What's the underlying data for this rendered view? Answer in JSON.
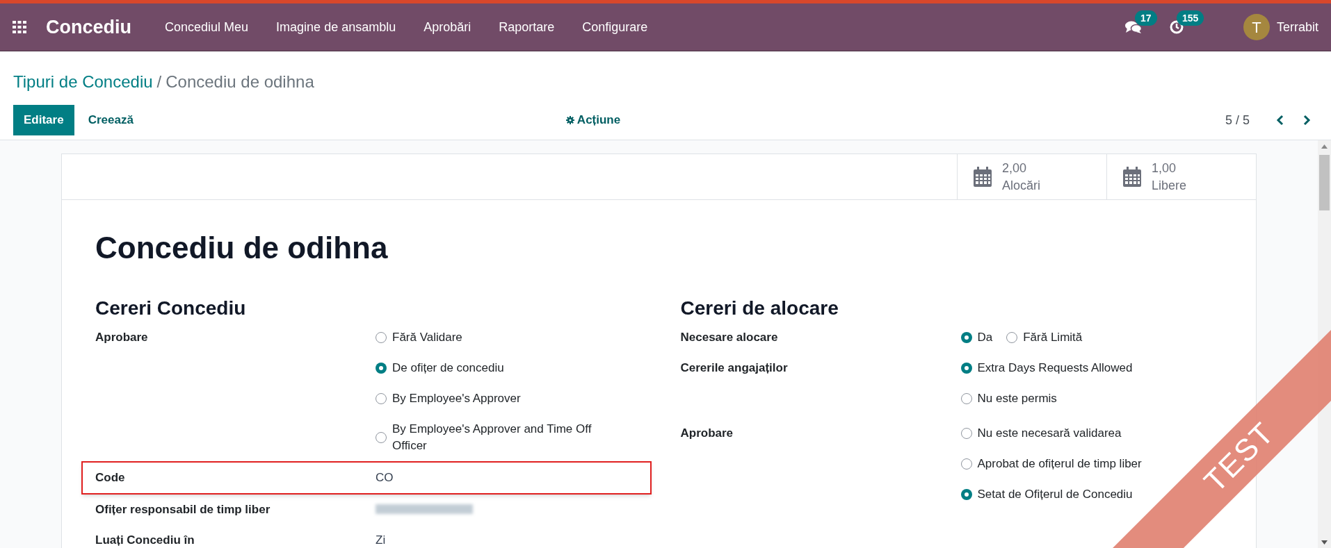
{
  "navbar": {
    "app_title": "Concediu",
    "menu": [
      "Concediul Meu",
      "Imagine de ansamblu",
      "Aprobări",
      "Raportare",
      "Configurare"
    ],
    "messages_badge": "17",
    "activity_badge": "155",
    "user": {
      "initial": "T",
      "name": "Terrabit"
    }
  },
  "breadcrumb": {
    "parent": "Tipuri de Concediu",
    "separator": "/",
    "current": "Concediu de odihna"
  },
  "control_panel": {
    "edit_button": "Editare",
    "create_button": "Creează",
    "action_button": "Acțiune",
    "pager": "5 / 5"
  },
  "stat_buttons": [
    {
      "value": "2,00",
      "label": "Alocări"
    },
    {
      "value": "1,00",
      "label": "Libere"
    }
  ],
  "title": "Concediu de odihna",
  "sections": [
    {
      "heading": "Cereri Concediu",
      "fields": [
        {
          "label": "Aprobare",
          "kind": "radio",
          "options": [
            {
              "label": "Fără Validare",
              "selected": false
            },
            {
              "label": "De ofițer de concediu",
              "selected": true
            },
            {
              "label": "By Employee's Approver",
              "selected": false
            },
            {
              "label": "By Employee's Approver and Time Off Officer",
              "selected": false
            }
          ]
        },
        {
          "label": "Code",
          "kind": "text",
          "value": "CO",
          "highlighted": true
        },
        {
          "label": "Ofițer responsabil de timp liber",
          "kind": "blurred"
        },
        {
          "label": "Luați Concediu în",
          "kind": "text",
          "value": "Zi",
          "highlighted": false
        }
      ]
    },
    {
      "heading": "Cereri de alocare",
      "fields": [
        {
          "label": "Necesare alocare",
          "kind": "radio_inline",
          "options": [
            {
              "label": "Da",
              "selected": true
            },
            {
              "label": "Fără Limită",
              "selected": false
            }
          ]
        },
        {
          "label": "Cererile angajaților",
          "kind": "radio",
          "options": [
            {
              "label": "Extra Days Requests Allowed",
              "selected": true
            },
            {
              "label": "Nu este permis",
              "selected": false
            }
          ]
        },
        {
          "label": "Aprobare",
          "kind": "radio",
          "options": [
            {
              "label": "Nu este necesară validarea",
              "selected": false
            },
            {
              "label": "Aprobat de ofițerul de timp liber",
              "selected": false
            },
            {
              "label": "Setat de Ofițerul de Concediu",
              "selected": true
            }
          ]
        }
      ]
    }
  ],
  "ribbon": "TEST"
}
